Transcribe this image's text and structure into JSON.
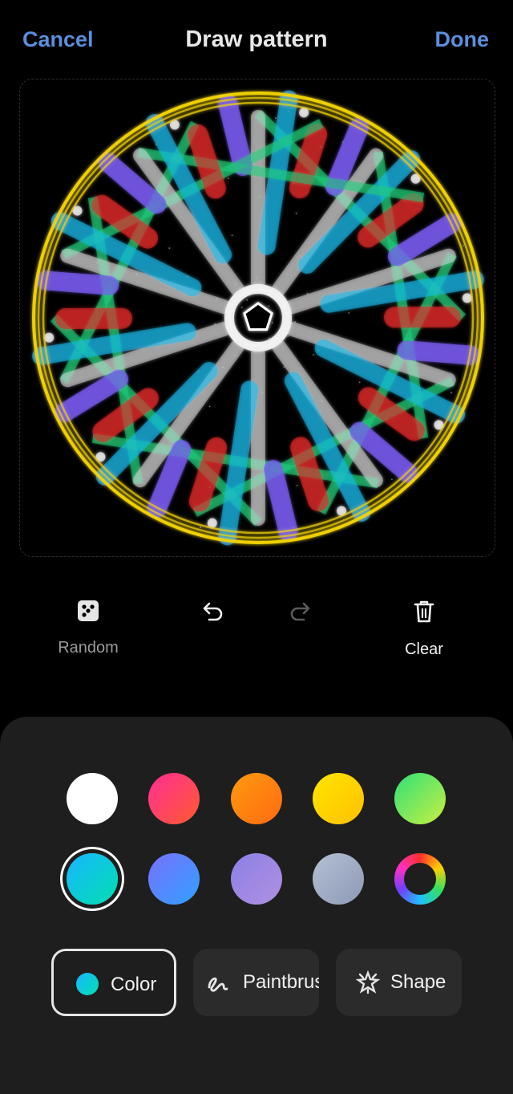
{
  "header": {
    "cancel_label": "Cancel",
    "title": "Draw pattern",
    "done_label": "Done"
  },
  "canvas": {
    "content": "kaleidoscope-pattern",
    "symmetry": 10,
    "ring_color": "#f2d400"
  },
  "tools": {
    "random_label": "Random",
    "clear_label": "Clear",
    "random_icon": "dice-icon",
    "undo_icon": "undo-icon",
    "redo_icon": "redo-icon",
    "clear_icon": "trash-icon"
  },
  "palette": {
    "selected": "cyan",
    "swatches": [
      {
        "name": "white",
        "colors": [
          "#ffffff",
          "#ffffff"
        ]
      },
      {
        "name": "pink-red",
        "colors": [
          "#ff2e95",
          "#ff5a30"
        ]
      },
      {
        "name": "orange",
        "colors": [
          "#ff9a10",
          "#ff6a10"
        ]
      },
      {
        "name": "yellow",
        "colors": [
          "#ffe600",
          "#ffc000"
        ]
      },
      {
        "name": "green",
        "colors": [
          "#2fe07a",
          "#c8f040"
        ]
      },
      {
        "name": "cyan",
        "colors": [
          "#19b6ff",
          "#00e0b0"
        ]
      },
      {
        "name": "blue-violet",
        "colors": [
          "#7a70ff",
          "#30a0ff"
        ]
      },
      {
        "name": "lavender",
        "colors": [
          "#8c80e6",
          "#b090e0"
        ]
      },
      {
        "name": "gray-blue",
        "colors": [
          "#b5c0d5",
          "#8d9ab5"
        ]
      },
      {
        "name": "color-wheel",
        "colors": [
          "rainbow",
          "rainbow"
        ]
      }
    ]
  },
  "tabs": {
    "color_label": "Color",
    "paintbrush_label": "Paintbrush",
    "shape_label": "Shape",
    "active": "Color"
  }
}
